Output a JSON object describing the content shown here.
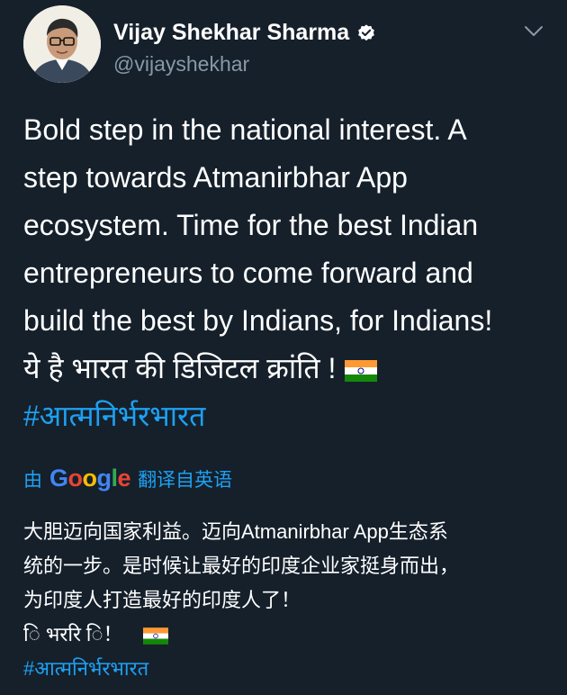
{
  "user": {
    "name": "Vijay Shekhar Sharma",
    "handle": "@vijayshekhar"
  },
  "tweet": {
    "lines": [
      "Bold step in the national interest. A",
      "step towards Atmanirbhar App",
      "ecosystem. Time for the best Indian",
      "entrepreneurs to come forward and",
      "build the best by Indians, for Indians!",
      "ये है भारत की डिजिटल क्रांति !"
    ],
    "hashtag": "#आत्मनिर्भरभारत"
  },
  "translation": {
    "prefix": "由",
    "provider": "Google",
    "suffix": "翻译自英语",
    "lines": [
      "大胆迈向国家利益。迈向Atmanirbhar App生态系",
      "统的一步。是时候让最好的印度企业家挺身而出，",
      "为印度人打造最好的印度人了！",
      "ि भररि ि！"
    ],
    "hashtag": "#आत्मनिर्भरभारत"
  },
  "colors": {
    "background": "#15202b",
    "link": "#1da1f2",
    "secondary_text": "#8899a6"
  },
  "icons": [
    "verified-badge-icon",
    "chevron-down-icon",
    "india-flag-icon"
  ]
}
